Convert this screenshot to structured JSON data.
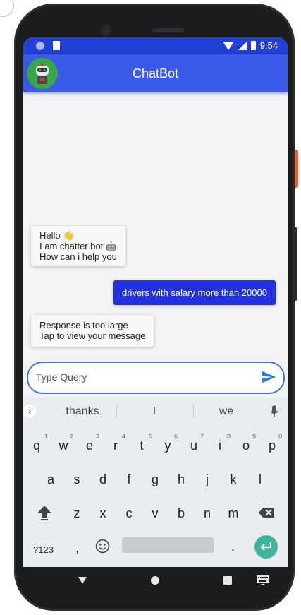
{
  "status_bar": {
    "time": "9:54"
  },
  "app_bar": {
    "title": "ChatBot"
  },
  "messages": [
    {
      "from": "bot",
      "lines": [
        "Hello 👋",
        "I am chatter bot 🤖",
        "How can i help you"
      ]
    },
    {
      "from": "user",
      "lines": [
        "drivers with salary more than 20000"
      ]
    },
    {
      "from": "bot",
      "lines": [
        "Response is too large",
        "Tap to view your message"
      ]
    }
  ],
  "input": {
    "placeholder": "Type Query",
    "value": ""
  },
  "keyboard": {
    "suggestions": [
      "thanks",
      "I",
      "we"
    ],
    "row1": [
      "q",
      "w",
      "e",
      "r",
      "t",
      "y",
      "u",
      "i",
      "o",
      "p"
    ],
    "row1_hints": [
      "1",
      "2",
      "3",
      "4",
      "5",
      "6",
      "7",
      "8",
      "9",
      "0"
    ],
    "row2": [
      "a",
      "s",
      "d",
      "f",
      "g",
      "h",
      "j",
      "k",
      "l"
    ],
    "row3": [
      "z",
      "x",
      "c",
      "v",
      "b",
      "n",
      "m"
    ],
    "row4": {
      "symbols": "?123",
      "comma": ",",
      "period": "."
    }
  },
  "colors": {
    "status_bar": "#2340d6",
    "app_bar": "#3c5ae8",
    "user_bubble": "#2332e0",
    "enter_key": "#3fb39c",
    "input_border": "#3b78d8"
  }
}
